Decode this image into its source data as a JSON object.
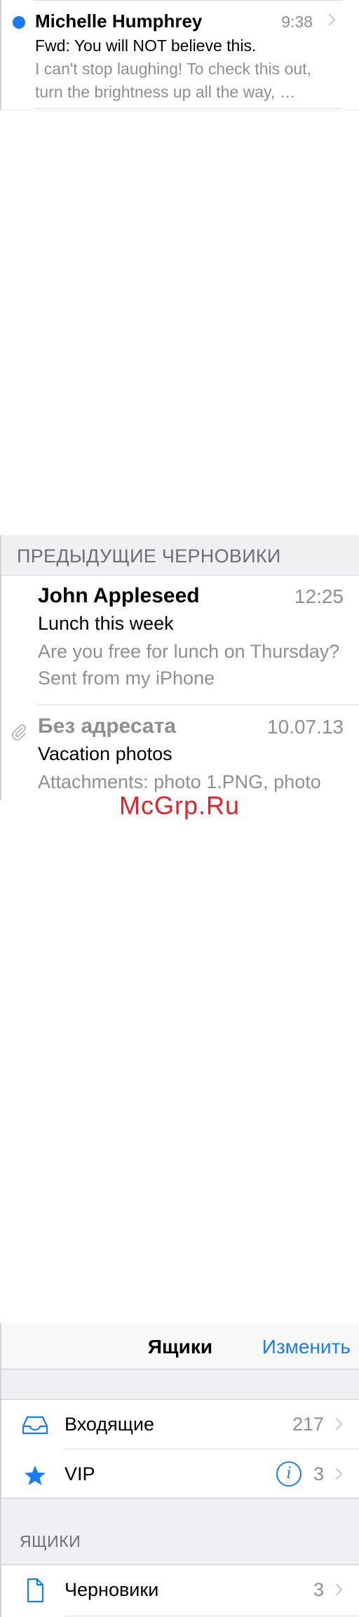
{
  "inbox_message": {
    "sender": "Michelle Humphrey",
    "time": "9:38",
    "subject": "Fwd: You will NOT believe this.",
    "preview": "I can't stop laughing! To check this out, turn the brightness up all the way, …",
    "unread": true
  },
  "drafts": {
    "header": "ПРЕДЫДУЩИЕ ЧЕРНОВИКИ",
    "items": [
      {
        "sender": "John Appleseed",
        "time": "12:25",
        "subject": "Lunch this week",
        "preview": "Are you free for lunch on Thursday? Sent from my iPhone"
      },
      {
        "sender": "Без адресата",
        "time": "10.07.13",
        "subject": "Vacation photos",
        "preview": "Attachments: photo 1.PNG, photo",
        "has_attachment": true
      }
    ]
  },
  "watermark": "McGrp.Ru",
  "mailboxes": {
    "title": "Ящики",
    "edit_label": "Изменить",
    "rows": [
      {
        "label": "Входящие",
        "count": "217",
        "icon": "inbox-tray-icon"
      },
      {
        "label": "VIP",
        "count": "3",
        "icon": "star-icon"
      }
    ],
    "section_label": "ЯЩИКИ",
    "section_rows": [
      {
        "label": "Черновики",
        "count": "3",
        "icon": "document-icon"
      }
    ]
  },
  "colors": {
    "accent": "#1a7cf5",
    "secondary_text": "#8e8e93",
    "group_background": "#efeff4",
    "watermark": "#e0232a"
  }
}
